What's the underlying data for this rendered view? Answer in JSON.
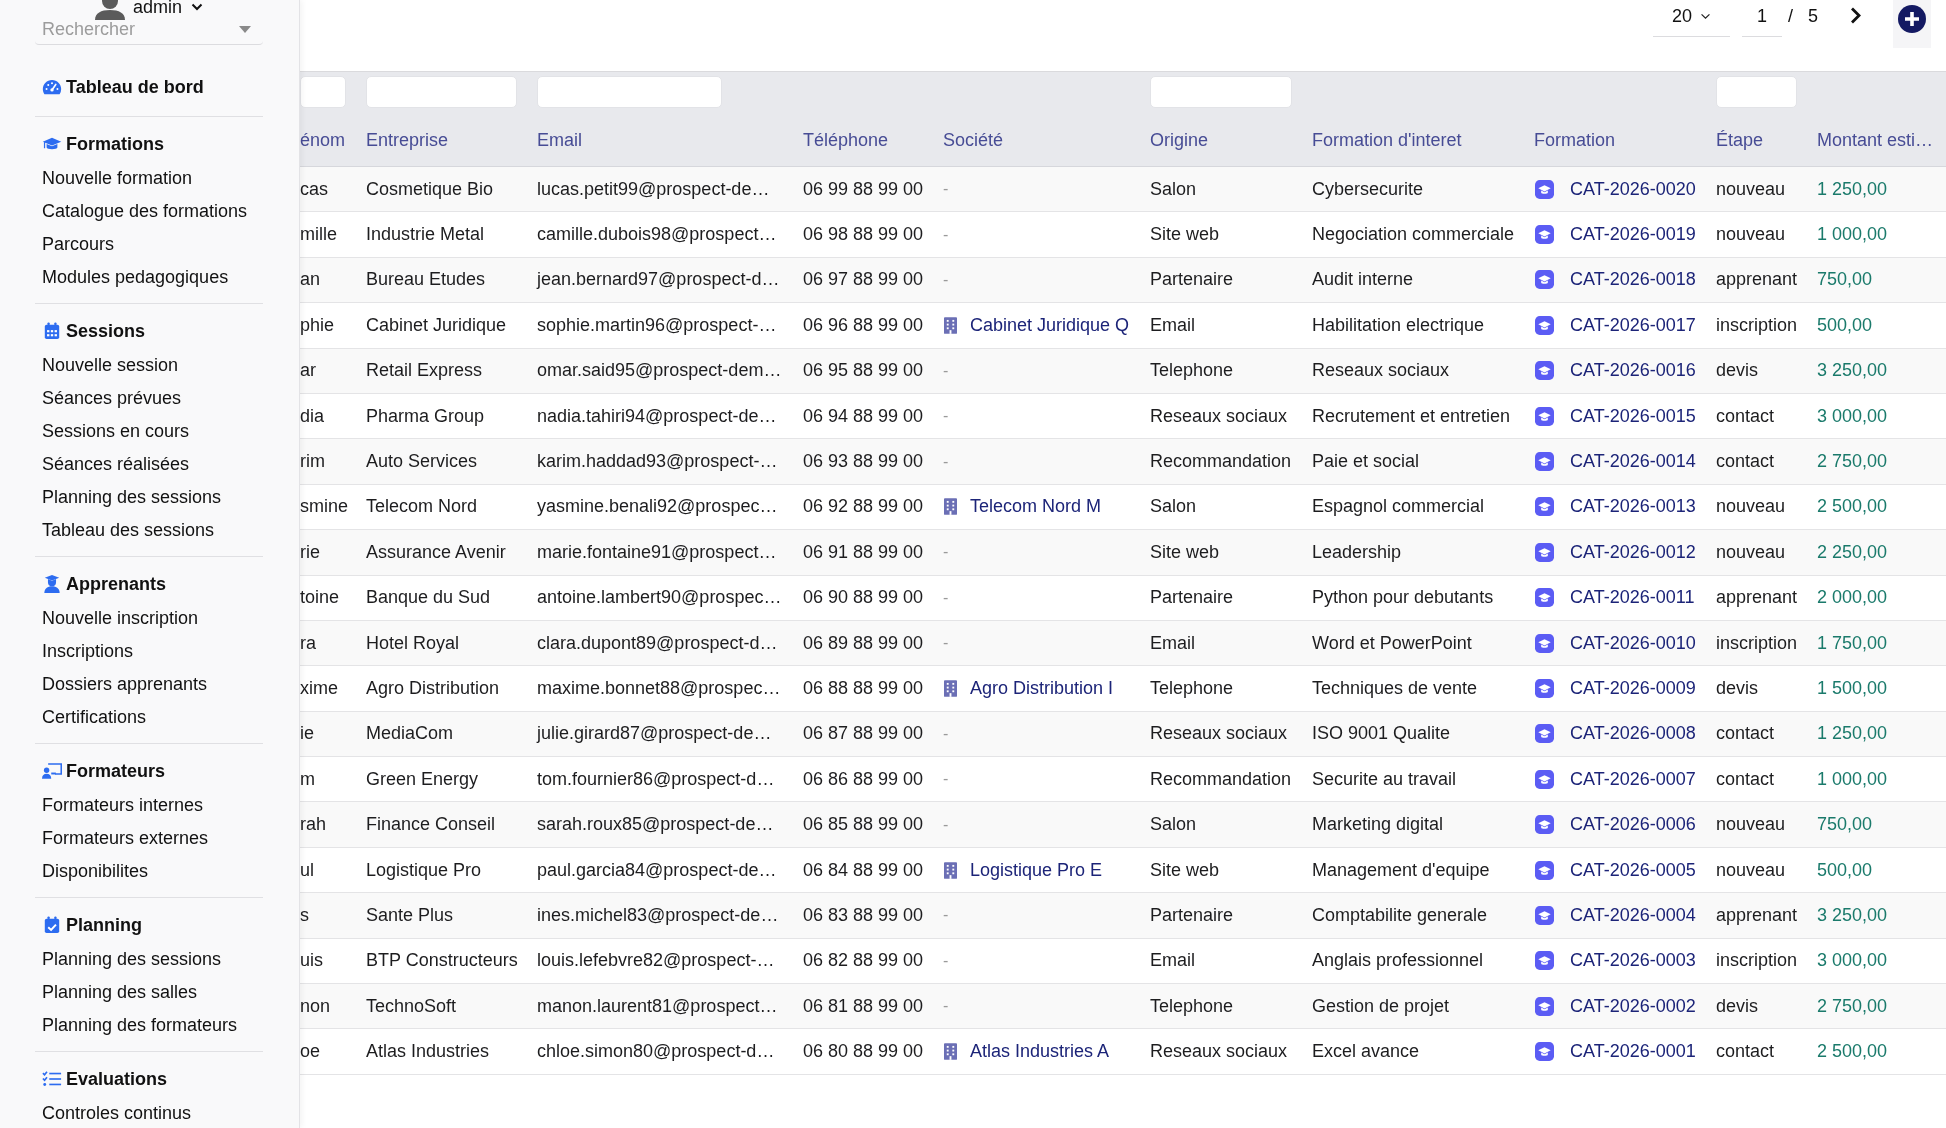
{
  "user": {
    "name": "admin"
  },
  "sidebar": {
    "search": {
      "placeholder": "Rechercher"
    },
    "sections": [
      {
        "title": "Tableau de bord"
      },
      {
        "title": "Formations",
        "items": [
          "Nouvelle formation",
          "Catalogue des formations",
          "Parcours",
          "Modules pedagogiques"
        ]
      },
      {
        "title": "Sessions",
        "items": [
          "Nouvelle session",
          "Séances prévues",
          "Sessions en cours",
          "Séances réalisées",
          "Planning des sessions",
          "Tableau des sessions"
        ]
      },
      {
        "title": "Apprenants",
        "items": [
          "Nouvelle inscription",
          "Inscriptions",
          "Dossiers apprenants",
          "Certifications"
        ]
      },
      {
        "title": "Formateurs",
        "items": [
          "Formateurs internes",
          "Formateurs externes",
          "Disponibilites"
        ]
      },
      {
        "title": "Planning",
        "items": [
          "Planning des sessions",
          "Planning des salles",
          "Planning des formateurs"
        ]
      },
      {
        "title": "Evaluations",
        "items": [
          "Controles continus"
        ]
      }
    ]
  },
  "pagination": {
    "page_size": "20",
    "page": "1",
    "separator": "/",
    "page_count": "5"
  },
  "table": {
    "columns": [
      {
        "label": "énom",
        "filter": true
      },
      {
        "label": "Entreprise",
        "filter": true
      },
      {
        "label": "Email",
        "filter": true
      },
      {
        "label": "Téléphone",
        "filter": false
      },
      {
        "label": "Société",
        "filter": false
      },
      {
        "label": "Origine",
        "filter": true
      },
      {
        "label": "Formation d'interet",
        "filter": false
      },
      {
        "label": "Formation",
        "filter": false
      },
      {
        "label": "Étape",
        "filter": true
      },
      {
        "label": "Montant esti…",
        "filter": false
      }
    ],
    "rows": [
      {
        "column_1": "cas",
        "entreprise": "Cosmetique Bio",
        "email": "lucas.petit99@prospect-de…",
        "telephone": "06 99 88 99 00",
        "societe": {
          "kind": "none",
          "text": "-"
        },
        "origine": "Salon",
        "formation_interet": "Cybersecurite",
        "formation": "CAT-2026-0020",
        "etape": "nouveau",
        "montant": "1 250,00"
      },
      {
        "column_1": "mille",
        "entreprise": "Industrie Metal",
        "email": "camille.dubois98@prospect…",
        "telephone": "06 98 88 99 00",
        "societe": {
          "kind": "none",
          "text": "-"
        },
        "origine": "Site web",
        "formation_interet": "Negociation commerciale",
        "formation": "CAT-2026-0019",
        "etape": "nouveau",
        "montant": "1 000,00"
      },
      {
        "column_1": "an",
        "entreprise": "Bureau Etudes",
        "email": "jean.bernard97@prospect-d…",
        "telephone": "06 97 88 99 00",
        "societe": {
          "kind": "none",
          "text": "-"
        },
        "origine": "Partenaire",
        "formation_interet": "Audit interne",
        "formation": "CAT-2026-0018",
        "etape": "apprenant",
        "montant": "750,00"
      },
      {
        "column_1": "phie",
        "entreprise": "Cabinet Juridique",
        "email": "sophie.martin96@prospect-…",
        "telephone": "06 96 88 99 00",
        "societe": {
          "kind": "company",
          "text": "Cabinet Juridique Q"
        },
        "origine": "Email",
        "formation_interet": "Habilitation electrique",
        "formation": "CAT-2026-0017",
        "etape": "inscription",
        "montant": "500,00"
      },
      {
        "column_1": "ar",
        "entreprise": "Retail Express",
        "email": "omar.said95@prospect-dem…",
        "telephone": "06 95 88 99 00",
        "societe": {
          "kind": "none",
          "text": "-"
        },
        "origine": "Telephone",
        "formation_interet": "Reseaux sociaux",
        "formation": "CAT-2026-0016",
        "etape": "devis",
        "montant": "3 250,00"
      },
      {
        "column_1": "dia",
        "entreprise": "Pharma Group",
        "email": "nadia.tahiri94@prospect-de…",
        "telephone": "06 94 88 99 00",
        "societe": {
          "kind": "none",
          "text": "-"
        },
        "origine": "Reseaux sociaux",
        "formation_interet": "Recrutement et entretien",
        "formation": "CAT-2026-0015",
        "etape": "contact",
        "montant": "3 000,00"
      },
      {
        "column_1": "rim",
        "entreprise": "Auto Services",
        "email": "karim.haddad93@prospect-…",
        "telephone": "06 93 88 99 00",
        "societe": {
          "kind": "none",
          "text": "-"
        },
        "origine": "Recommandation",
        "formation_interet": "Paie et social",
        "formation": "CAT-2026-0014",
        "etape": "contact",
        "montant": "2 750,00"
      },
      {
        "column_1": "smine",
        "entreprise": "Telecom Nord",
        "email": "yasmine.benali92@prospec…",
        "telephone": "06 92 88 99 00",
        "societe": {
          "kind": "company",
          "text": "Telecom Nord M"
        },
        "origine": "Salon",
        "formation_interet": "Espagnol commercial",
        "formation": "CAT-2026-0013",
        "etape": "nouveau",
        "montant": "2 500,00"
      },
      {
        "column_1": "rie",
        "entreprise": "Assurance Avenir",
        "email": "marie.fontaine91@prospect…",
        "telephone": "06 91 88 99 00",
        "societe": {
          "kind": "none",
          "text": "-"
        },
        "origine": "Site web",
        "formation_interet": "Leadership",
        "formation": "CAT-2026-0012",
        "etape": "nouveau",
        "montant": "2 250,00"
      },
      {
        "column_1": "toine",
        "entreprise": "Banque du Sud",
        "email": "antoine.lambert90@prospec…",
        "telephone": "06 90 88 99 00",
        "societe": {
          "kind": "none",
          "text": "-"
        },
        "origine": "Partenaire",
        "formation_interet": "Python pour debutants",
        "formation": "CAT-2026-0011",
        "etape": "apprenant",
        "montant": "2 000,00"
      },
      {
        "column_1": "ra",
        "entreprise": "Hotel Royal",
        "email": "clara.dupont89@prospect-d…",
        "telephone": "06 89 88 99 00",
        "societe": {
          "kind": "none",
          "text": "-"
        },
        "origine": "Email",
        "formation_interet": "Word et PowerPoint",
        "formation": "CAT-2026-0010",
        "etape": "inscription",
        "montant": "1 750,00"
      },
      {
        "column_1": "xime",
        "entreprise": "Agro Distribution",
        "email": "maxime.bonnet88@prospec…",
        "telephone": "06 88 88 99 00",
        "societe": {
          "kind": "company",
          "text": "Agro Distribution I"
        },
        "origine": "Telephone",
        "formation_interet": "Techniques de vente",
        "formation": "CAT-2026-0009",
        "etape": "devis",
        "montant": "1 500,00"
      },
      {
        "column_1": "ie",
        "entreprise": "MediaCom",
        "email": "julie.girard87@prospect-de…",
        "telephone": "06 87 88 99 00",
        "societe": {
          "kind": "none",
          "text": "-"
        },
        "origine": "Reseaux sociaux",
        "formation_interet": "ISO 9001 Qualite",
        "formation": "CAT-2026-0008",
        "etape": "contact",
        "montant": "1 250,00"
      },
      {
        "column_1": "m",
        "entreprise": "Green Energy",
        "email": "tom.fournier86@prospect-d…",
        "telephone": "06 86 88 99 00",
        "societe": {
          "kind": "none",
          "text": "-"
        },
        "origine": "Recommandation",
        "formation_interet": "Securite au travail",
        "formation": "CAT-2026-0007",
        "etape": "contact",
        "montant": "1 000,00"
      },
      {
        "column_1": "rah",
        "entreprise": "Finance Conseil",
        "email": "sarah.roux85@prospect-de…",
        "telephone": "06 85 88 99 00",
        "societe": {
          "kind": "none",
          "text": "-"
        },
        "origine": "Salon",
        "formation_interet": "Marketing digital",
        "formation": "CAT-2026-0006",
        "etape": "nouveau",
        "montant": "750,00"
      },
      {
        "column_1": "ul",
        "entreprise": "Logistique Pro",
        "email": "paul.garcia84@prospect-de…",
        "telephone": "06 84 88 99 00",
        "societe": {
          "kind": "company",
          "text": "Logistique Pro E"
        },
        "origine": "Site web",
        "formation_interet": "Management d'equipe",
        "formation": "CAT-2026-0005",
        "etape": "nouveau",
        "montant": "500,00"
      },
      {
        "column_1": "s",
        "entreprise": "Sante Plus",
        "email": "ines.michel83@prospect-de…",
        "telephone": "06 83 88 99 00",
        "societe": {
          "kind": "none",
          "text": "-"
        },
        "origine": "Partenaire",
        "formation_interet": "Comptabilite generale",
        "formation": "CAT-2026-0004",
        "etape": "apprenant",
        "montant": "3 250,00"
      },
      {
        "column_1": "uis",
        "entreprise": "BTP Constructeurs",
        "email": "louis.lefebvre82@prospect-…",
        "telephone": "06 82 88 99 00",
        "societe": {
          "kind": "none",
          "text": "-"
        },
        "origine": "Email",
        "formation_interet": "Anglais professionnel",
        "formation": "CAT-2026-0003",
        "etape": "inscription",
        "montant": "3 000,00"
      },
      {
        "column_1": "non",
        "entreprise": "TechnoSoft",
        "email": "manon.laurent81@prospect…",
        "telephone": "06 81 88 99 00",
        "societe": {
          "kind": "none",
          "text": "-"
        },
        "origine": "Telephone",
        "formation_interet": "Gestion de projet",
        "formation": "CAT-2026-0002",
        "etape": "devis",
        "montant": "2 750,00"
      },
      {
        "column_1": "oe",
        "entreprise": "Atlas Industries",
        "email": "chloe.simon80@prospect-d…",
        "telephone": "06 80 88 99 00",
        "societe": {
          "kind": "company",
          "text": "Atlas Industries A"
        },
        "origine": "Reseaux sociaux",
        "formation_interet": "Excel avance",
        "formation": "CAT-2026-0001",
        "etape": "contact",
        "montant": "2 500,00"
      }
    ]
  }
}
